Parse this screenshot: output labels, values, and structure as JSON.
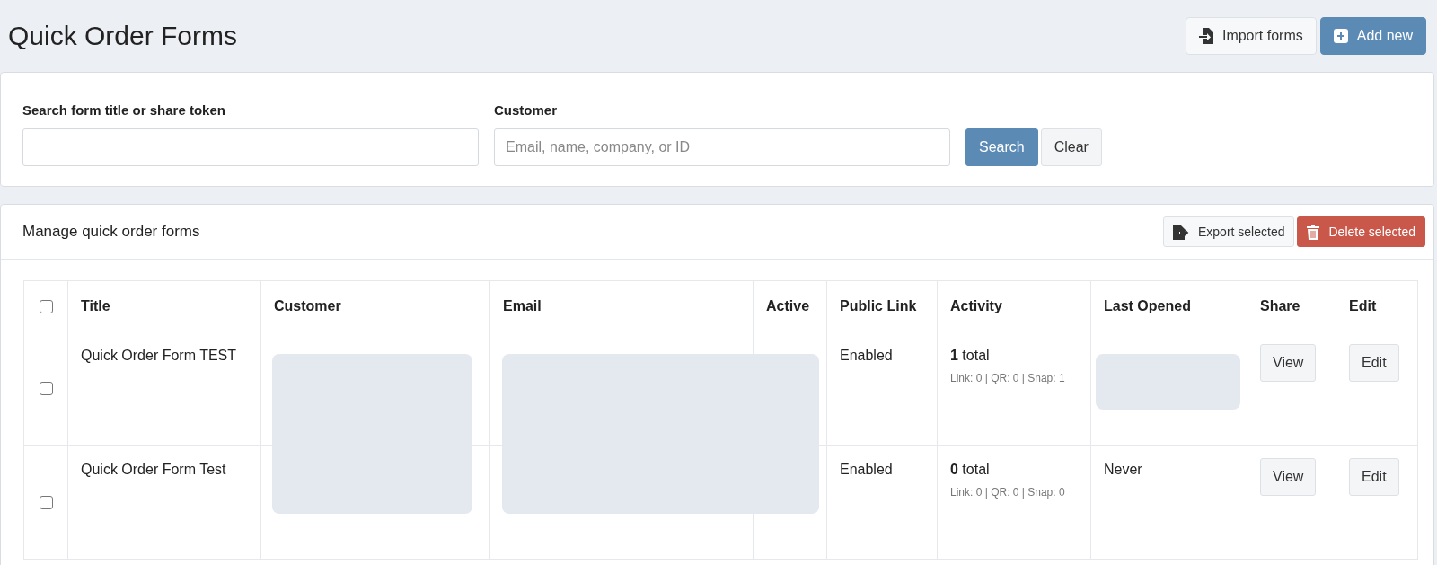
{
  "page_title": "Quick Order Forms",
  "header_buttons": [
    {
      "label": "Import forms",
      "kind": "import"
    },
    {
      "label": "Add new",
      "kind": "add"
    }
  ],
  "filters": {
    "search": {
      "label": "Search form title or share token"
    },
    "customer": {
      "label": "Customer",
      "placeholder": "Email, name, company, or ID"
    },
    "buttons": [
      {
        "label": "Search",
        "kind": "primary"
      },
      {
        "label": "Clear",
        "kind": "secondary"
      }
    ]
  },
  "panel": {
    "title": "Manage quick order forms",
    "buttons": [
      {
        "label": "Export selected",
        "kind": "export"
      },
      {
        "label": "Delete selected",
        "kind": "delete"
      }
    ]
  },
  "table": {
    "select_all_checked": false,
    "columns": [
      "Title",
      "Customer",
      "Email",
      "Active",
      "Public Link",
      "Activity",
      "Last Opened",
      "Share",
      "Edit"
    ],
    "rows": [
      {
        "checked": false,
        "title": "Quick Order Form TEST",
        "public_link": "Enabled",
        "activity": "**1** total",
        "activity_detail": "Link: 0 | QR: 0 | Snap: 1",
        "share": "View",
        "edit": "Edit"
      },
      {
        "checked": false,
        "title": "Quick Order Form Test",
        "public_link": "Enabled",
        "activity": "**0** total",
        "activity_detail": "Link: 0 | QR: 0 | Snap: 0",
        "last_opened": "Never",
        "share": "View",
        "edit": "Edit"
      }
    ]
  }
}
